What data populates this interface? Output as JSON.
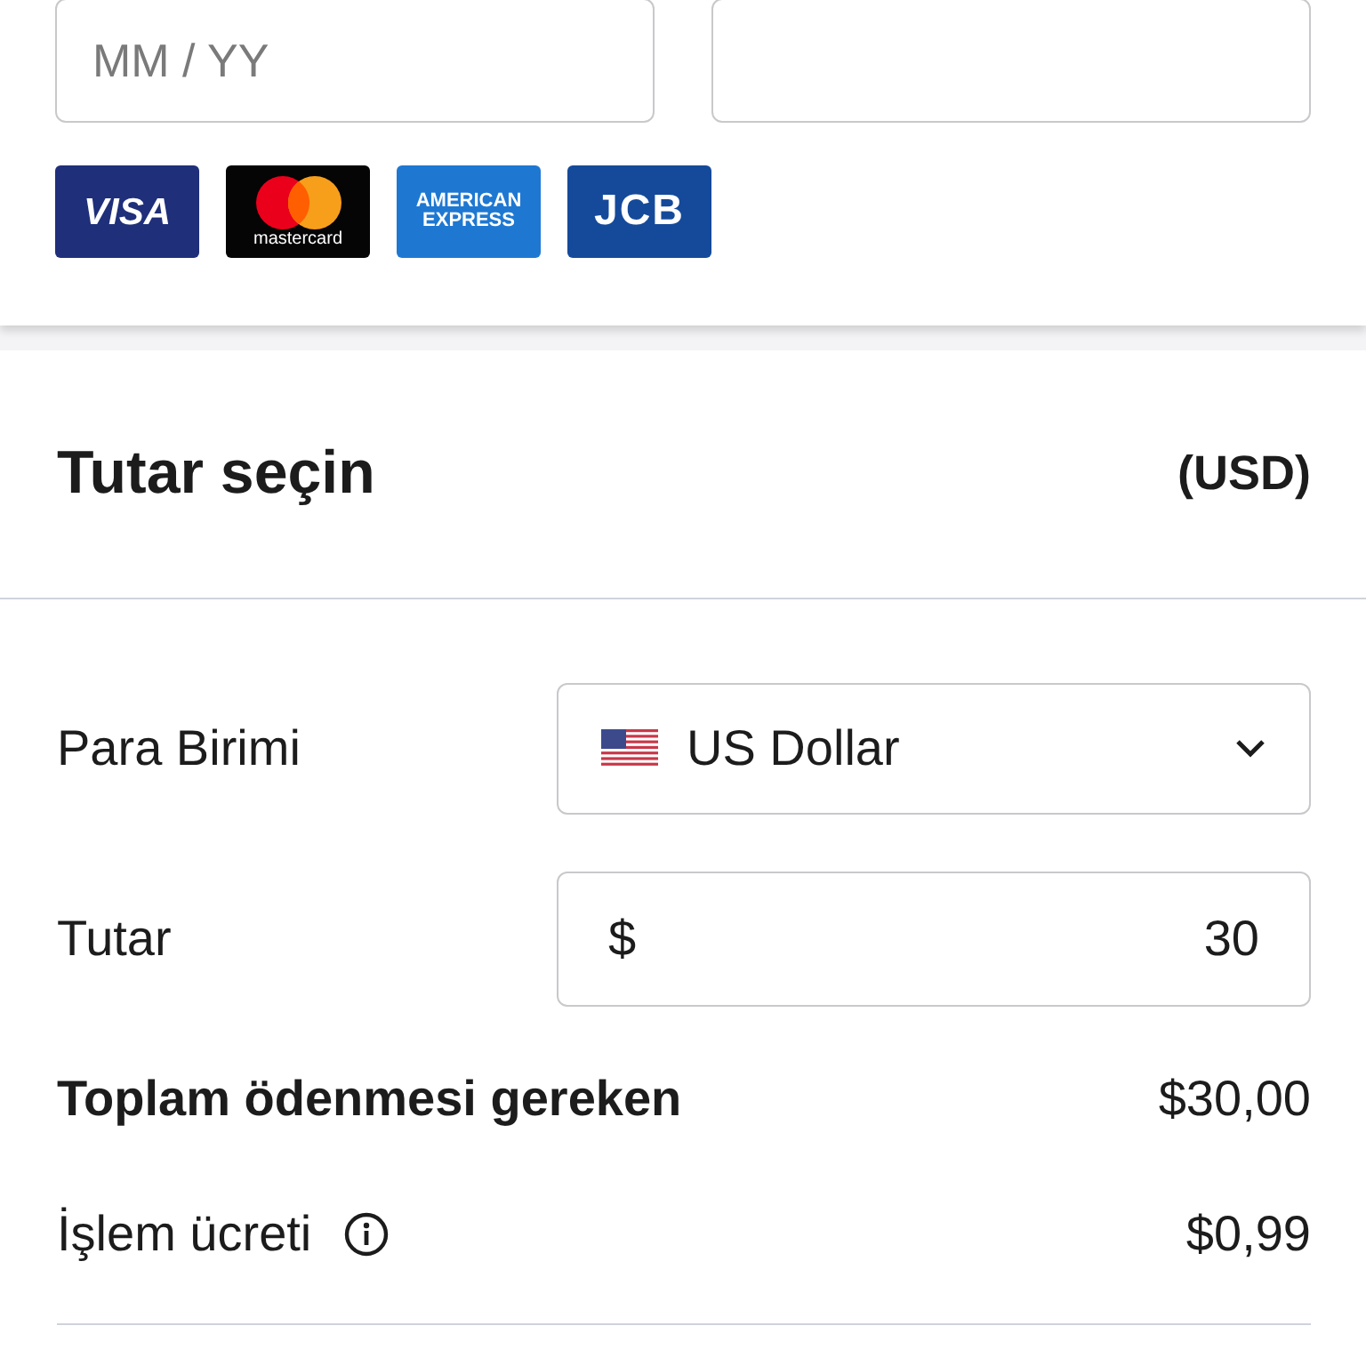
{
  "card_fields": [
    {
      "kind": "text",
      "placeholder": "MM / YY"
    },
    {
      "kind": "text"
    }
  ],
  "card_brands": [
    {
      "kind": "visa",
      "label": "VISA"
    },
    {
      "kind": "mastercard",
      "label": "mastercard"
    },
    {
      "kind": "amex",
      "label": "AMERICAN EXPRESS"
    },
    {
      "kind": "jcb",
      "label": "JCB"
    }
  ],
  "amount_section": {
    "title": "Tutar seçin",
    "currency_code": "(USD)",
    "currency": {
      "label": "Para Birimi",
      "value": "US Dollar"
    },
    "amount": {
      "label": "Tutar",
      "prefix": "$",
      "value": "30"
    },
    "total": {
      "label": "Toplam ödenmesi gereken",
      "value": "$30,00"
    },
    "fee": {
      "label": "İşlem ücreti",
      "value": "$0,99"
    }
  }
}
